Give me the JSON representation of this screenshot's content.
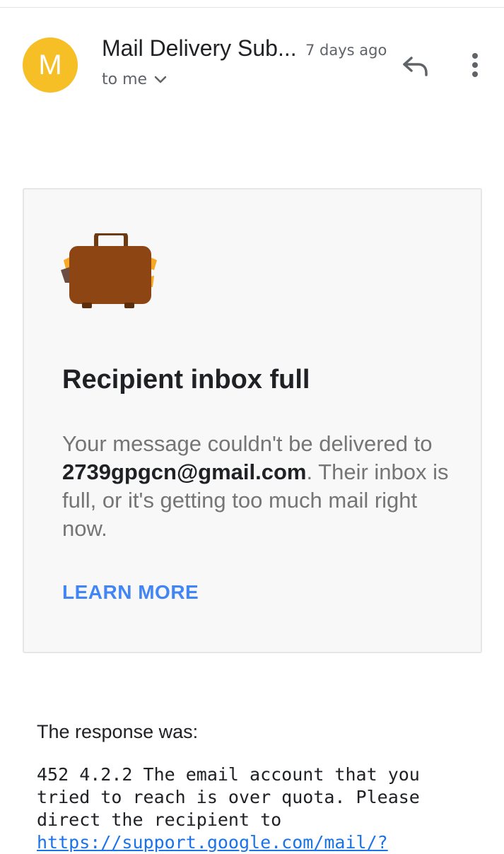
{
  "header": {
    "avatar_letter": "M",
    "avatar_color": "#f6bf26",
    "sender": "Mail Delivery Sub...",
    "time": "7 days ago",
    "recipient": "to me",
    "reply_icon": "reply-icon",
    "more_icon": "more-vert-icon"
  },
  "card": {
    "icon": "suitcase-icon",
    "title": "Recipient inbox full",
    "body_before": "Your message couldn't be delivered to ",
    "email": "2739gpgcn@gmail.com",
    "body_after": ". Their inbox is full, or it's getting too much mail right now.",
    "learn_more": "LEARN MORE",
    "link_color": "#4285f4"
  },
  "response": {
    "label": "The response was:",
    "text": "452 4.2.2 The email account that you\ntried to reach is over quota. Please\ndirect the recipient to\n",
    "link": "https://support.google.com/mail/?"
  }
}
